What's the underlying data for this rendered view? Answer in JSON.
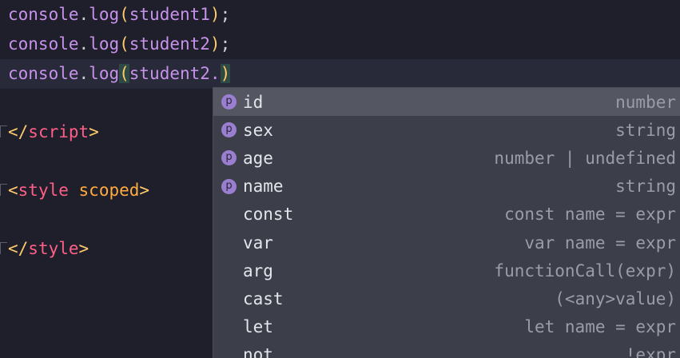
{
  "editor": {
    "lines": [
      {
        "obj": "console",
        "method": "log",
        "arg": "student1"
      },
      {
        "obj": "console",
        "method": "log",
        "arg": "student2"
      },
      {
        "obj": "console",
        "method": "log",
        "arg": "student2."
      }
    ],
    "tags": [
      {
        "open": "</",
        "name": "script",
        "close": ">"
      },
      {
        "open": "<",
        "name": "style",
        "attr": "scoped",
        "close": ">"
      },
      {
        "open": "</",
        "name": "style",
        "close": ">"
      }
    ]
  },
  "autocomplete": {
    "items": [
      {
        "label": "id",
        "type": "number",
        "icon": "property-icon",
        "icon_glyph": "p",
        "selected": true
      },
      {
        "label": "sex",
        "type": "string",
        "icon": "property-icon",
        "icon_glyph": "p"
      },
      {
        "label": "age",
        "type": "number | undefined",
        "icon": "property-icon",
        "icon_glyph": "p"
      },
      {
        "label": "name",
        "type": "string",
        "icon": "property-icon",
        "icon_glyph": "p"
      },
      {
        "label": "const",
        "type": "const name = expr"
      },
      {
        "label": "var",
        "type": "var name = expr"
      },
      {
        "label": "arg",
        "type": "functionCall(expr)"
      },
      {
        "label": "cast",
        "type": "(<any>value)"
      },
      {
        "label": "let",
        "type": "let name = expr"
      },
      {
        "label": "not",
        "type": "!expr"
      }
    ]
  }
}
